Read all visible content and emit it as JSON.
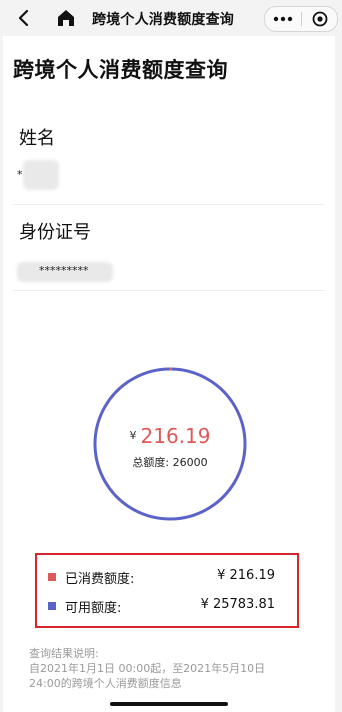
{
  "nav": {
    "title": "跨境个人消费额度查询"
  },
  "page": {
    "title": "跨境个人消费额度查询"
  },
  "fields": {
    "name_label": "姓名",
    "name_value": "*",
    "id_label": "身份证号",
    "id_value": "*********"
  },
  "summary": {
    "currency": "¥",
    "spent": "216.19",
    "total_label": "总额度:",
    "total": "26000"
  },
  "legend": {
    "spent_label": "已消费额度:",
    "spent_value": "¥  216.19",
    "available_label": "可用额度:",
    "available_value": "¥  25783.81"
  },
  "notes": {
    "heading": "查询结果说明:",
    "line1": "自2021年1月1日 00:00起，至2021年5月10日",
    "line2": "24:00的跨境个人消费额度信息"
  },
  "chart_data": {
    "type": "pie",
    "categories": [
      "已消费额度",
      "可用额度"
    ],
    "values": [
      216.19,
      25783.81
    ],
    "colors": [
      "#e0595a",
      "#5b63c8"
    ]
  }
}
